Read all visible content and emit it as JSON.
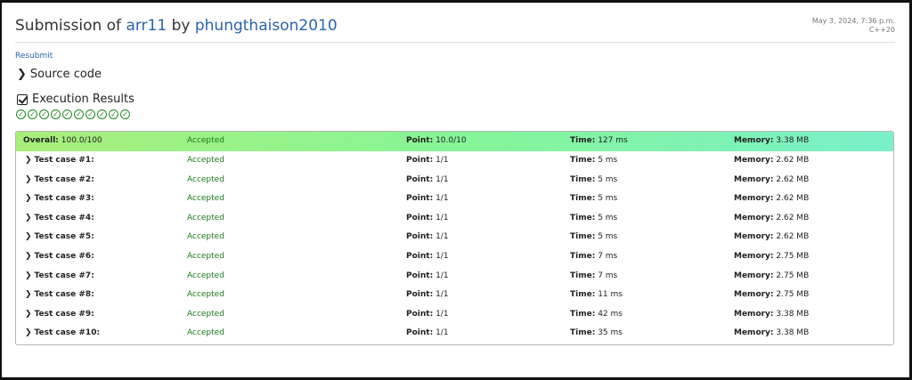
{
  "header": {
    "title_prefix": "Submission of",
    "problem": "arr11",
    "by": "by",
    "user": "phungthaison2010",
    "date": "May 3, 2024, 7:36 p.m.",
    "language": "C++20"
  },
  "resubmit_label": "Resubmit",
  "source_code_label": "Source code",
  "execution_results_label": "Execution Results",
  "check_count": 10,
  "labels": {
    "point": "Point:",
    "time": "Time:",
    "memory": "Memory:"
  },
  "overall": {
    "name": "Overall:",
    "score": "100.0/100",
    "status": "Accepted",
    "point": "10.0/10",
    "time": "127 ms",
    "memory": "3.38 MB"
  },
  "cases": [
    {
      "name": "Test case #1:",
      "status": "Accepted",
      "point": "1/1",
      "time": "5 ms",
      "memory": "2.62 MB"
    },
    {
      "name": "Test case #2:",
      "status": "Accepted",
      "point": "1/1",
      "time": "5 ms",
      "memory": "2.62 MB"
    },
    {
      "name": "Test case #3:",
      "status": "Accepted",
      "point": "1/1",
      "time": "5 ms",
      "memory": "2.62 MB"
    },
    {
      "name": "Test case #4:",
      "status": "Accepted",
      "point": "1/1",
      "time": "5 ms",
      "memory": "2.62 MB"
    },
    {
      "name": "Test case #5:",
      "status": "Accepted",
      "point": "1/1",
      "time": "5 ms",
      "memory": "2.62 MB"
    },
    {
      "name": "Test case #6:",
      "status": "Accepted",
      "point": "1/1",
      "time": "7 ms",
      "memory": "2.75 MB"
    },
    {
      "name": "Test case #7:",
      "status": "Accepted",
      "point": "1/1",
      "time": "7 ms",
      "memory": "2.75 MB"
    },
    {
      "name": "Test case #8:",
      "status": "Accepted",
      "point": "1/1",
      "time": "11 ms",
      "memory": "2.75 MB"
    },
    {
      "name": "Test case #9:",
      "status": "Accepted",
      "point": "1/1",
      "time": "42 ms",
      "memory": "3.38 MB"
    },
    {
      "name": "Test case #10:",
      "status": "Accepted",
      "point": "1/1",
      "time": "35 ms",
      "memory": "3.38 MB"
    }
  ],
  "icons": {
    "case_expand": "chevron-right-icon",
    "check": "check-circle-icon"
  },
  "colors": {
    "accepted": "#1d7a1d",
    "link": "#2a64a8",
    "overall_start": "#a9ee7a",
    "overall_end": "#7af0c9"
  }
}
